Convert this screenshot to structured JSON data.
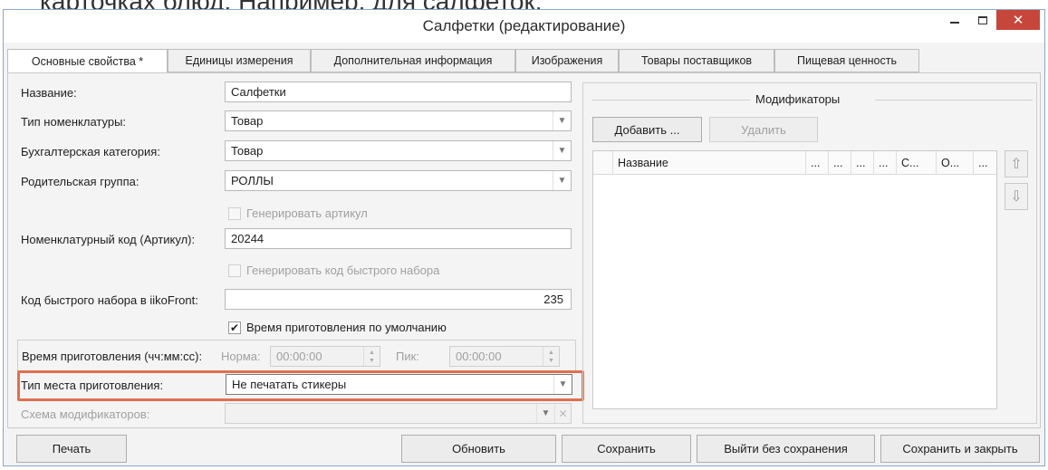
{
  "background_text": "карточках блюд. Например, для салфеток:",
  "window": {
    "title": "Салфетки (редактирование)",
    "close_glyph": "✕"
  },
  "tabs": [
    {
      "label": "Основные свойства *",
      "active": true
    },
    {
      "label": "Единицы измерения"
    },
    {
      "label": "Дополнительная информация"
    },
    {
      "label": "Изображения"
    },
    {
      "label": "Товары поставщиков"
    },
    {
      "label": "Пищевая ценность"
    }
  ],
  "form": {
    "name_label": "Название:",
    "name_value": "Салфетки",
    "nomenclature_type_label": "Тип номенклатуры:",
    "nomenclature_type_value": "Товар",
    "accounting_category_label": "Бухгалтерская категория:",
    "accounting_category_value": "Товар",
    "parent_group_label": "Родительская группа:",
    "parent_group_value": "РОЛЛЫ",
    "generate_article_label": "Генерировать артикул",
    "article_code_label": "Номенклатурный код (Артикул):",
    "article_code_value": "20244",
    "generate_quick_code_label": "Генерировать код быстрого набора",
    "quick_code_label": "Код быстрого набора в iikoFront:",
    "quick_code_value": "235",
    "default_cook_time_label": "Время приготовления по умолчанию",
    "default_cook_time_checked": true,
    "check_glyph": "✔",
    "cook_time_label": "Время приготовления (чч:мм:сс):",
    "norm_label": "Норма:",
    "norm_value": "00:00:00",
    "peak_label": "Пик:",
    "peak_value": "00:00:00",
    "cook_place_type_label": "Тип места приготовления:",
    "cook_place_type_value": "Не печатать стикеры",
    "modifier_scheme_label": "Схема модификаторов:",
    "modifier_scheme_value": ""
  },
  "modifiers": {
    "title": "Модификаторы",
    "add_label": "Добавить ...",
    "delete_label": "Удалить",
    "columns": [
      "Название",
      "...",
      "...",
      "...",
      "...",
      "С...",
      "О...",
      "..."
    ],
    "up_glyph": "⇧",
    "down_glyph": "⇩"
  },
  "footer": {
    "print_label": "Печать",
    "refresh_label": "Обновить",
    "save_label": "Сохранить",
    "exit_label": "Выйти без сохранения",
    "save_close_label": "Сохранить и закрыть"
  },
  "colors": {
    "highlight": "#e0704e",
    "close_button": "#c7463c",
    "window_border": "#8aa9cc"
  }
}
